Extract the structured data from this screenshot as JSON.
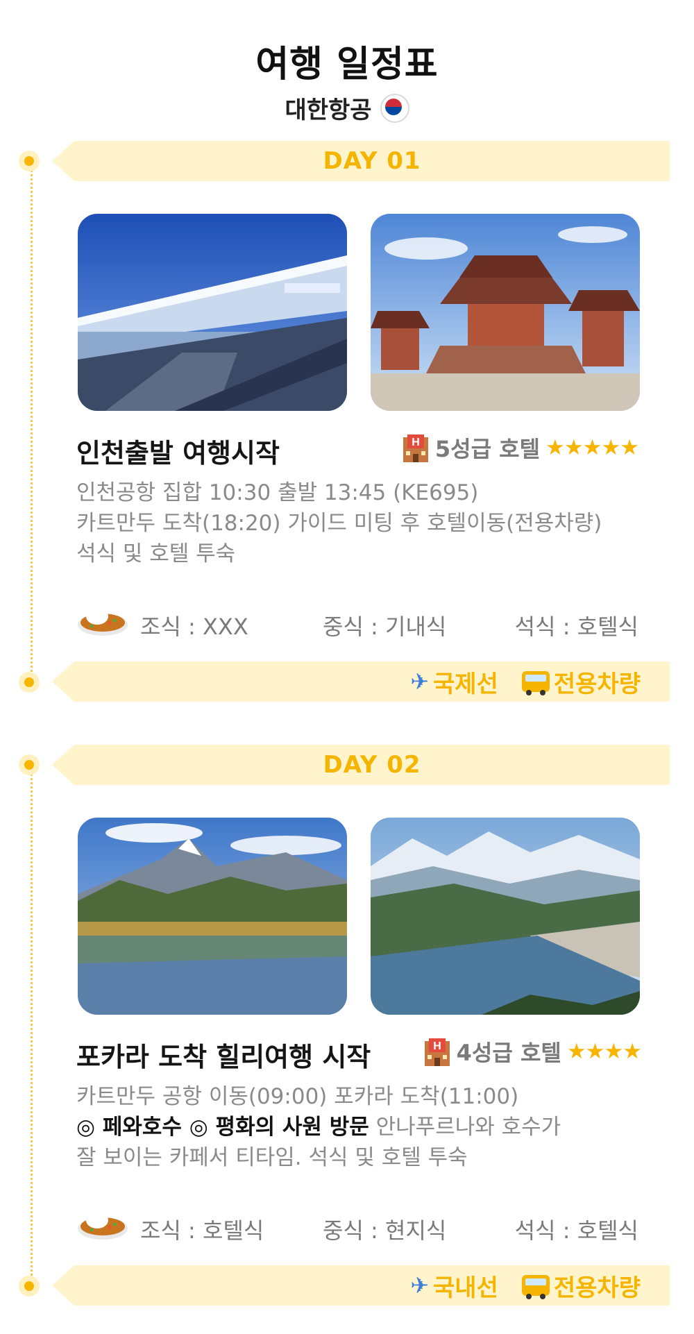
{
  "header": {
    "title": "여행 일정표",
    "airline": "대한항공"
  },
  "days": [
    {
      "label": "DAY 01",
      "title": "인천출발 여행시작",
      "hotel": {
        "label": "5성급 호텔",
        "stars": "★★★★★"
      },
      "desc": {
        "line1": "인천공항 집합 10:30 출발 13:45 (KE695)",
        "line2": "카트만두 도착(18:20) 가이드 미팅 후 호텔이동(전용차량)",
        "line3": "석식 및 호텔 투숙"
      },
      "meals": {
        "breakfast": "조식 : XXX",
        "lunch": "중식 : 기내식",
        "dinner": "석식 : 호텔식"
      },
      "transport": {
        "flight": "국제선",
        "vehicle": "전용차량"
      }
    },
    {
      "label": "DAY 02",
      "title": "포카라 도착 힐리여행 시작",
      "hotel": {
        "label": "4성급 호텔",
        "stars": "★★★★"
      },
      "desc": {
        "line1": "카트만두 공항 이동(09:00) 포카라 도착(11:00)",
        "highlight": "◎ 페와호수 ◎ 평화의 사원 방문",
        "line2_rest": " 안나푸르나와 호수가",
        "line3": "잘 보이는 카페서 티타임. 석식 및 호텔 투숙"
      },
      "meals": {
        "breakfast": "조식 : 호텔식",
        "lunch": "중식 : 현지식",
        "dinner": "석식 : 호텔식"
      },
      "transport": {
        "flight": "국내선",
        "vehicle": "전용차량"
      }
    }
  ],
  "colors": {
    "accent": "#f5b400",
    "ribbon": "#fff4cc",
    "muted": "#8a8a8a"
  },
  "icons": [
    "korean-air-logo-icon",
    "hotel-icon",
    "curry-rice-icon",
    "airplane-icon",
    "bus-icon",
    "timeline-dot-icon"
  ]
}
